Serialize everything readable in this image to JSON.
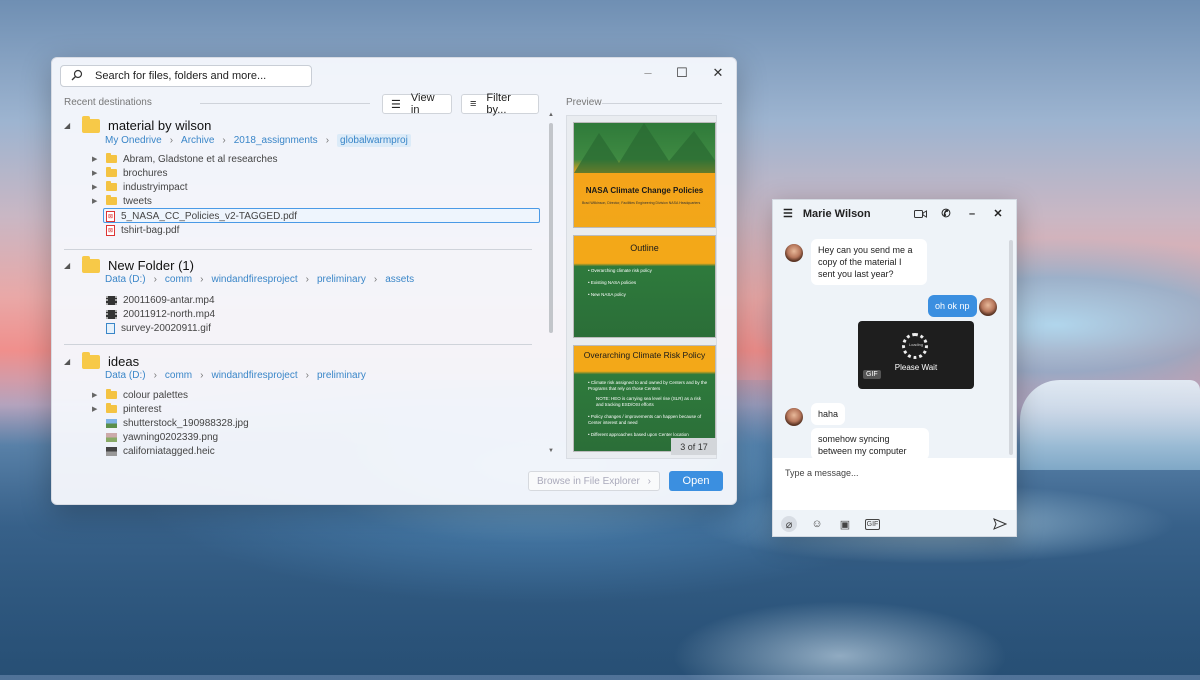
{
  "search": {
    "placeholder": "Search for files, folders and more..."
  },
  "sections": {
    "recent": "Recent destinations",
    "preview": "Preview"
  },
  "toolbar": {
    "view_in": "View in",
    "filter_by": "Filter by..."
  },
  "groups": [
    {
      "title": "material by wilson",
      "crumbs": [
        "My Onedrive",
        "Archive",
        "2018_assignments",
        "globalwarmproj"
      ],
      "items": [
        "Abram, Gladstone et al researches",
        "brochures",
        "industryimpact",
        "tweets",
        "5_NASA_CC_Policies_v2-TAGGED.pdf",
        "tshirt-bag.pdf"
      ]
    },
    {
      "title": "New Folder (1)",
      "crumbs": [
        "Data (D:)",
        "comm",
        "windandfiresproject",
        "preliminary",
        "assets"
      ],
      "items": [
        "20011609-antar.mp4",
        "20011912-north.mp4",
        "survey-20020911.gif"
      ]
    },
    {
      "title": "ideas",
      "crumbs": [
        "Data (D:)",
        "comm",
        "windandfiresproject",
        "preliminary"
      ],
      "items": [
        "colour palettes",
        "pinterest",
        "shutterstock_190988328.jpg",
        "yawning0202339.png",
        "californiatagged.heic"
      ]
    }
  ],
  "slides": {
    "s1_title": "NASA Climate Change Policies",
    "s1_sub": "Brad Wilkinson, Director, Facilities Engineering Division NASA Headquarters",
    "s2_title": "Outline",
    "s2_bullets": [
      "Overarching climate risk policy",
      "Existing NASA policies",
      "New NASA policy"
    ],
    "s3_title": "Overarching Climate Risk Policy",
    "s3_bullets": [
      "Climate risk assigned to and owned by Centers and by the Programs that rely on those Centers",
      "NOTE: HEO is carrying sea level rise (SLR) as a risk and tracking ESD/OSI efforts",
      "Policy changes / improvements can happen because of Center interest and need",
      "Different approaches based upon Center location"
    ],
    "page": "3 of 17"
  },
  "footer": {
    "browse": "Browse in File Explorer",
    "open": "Open"
  },
  "chat": {
    "name": "Marie Wilson",
    "messages": [
      "Hey can you send me a copy of the material I sent you last year?",
      "oh ok np",
      "haha",
      "somehow syncing between my computer and a device didnt merge things but"
    ],
    "gif_text": "Please Wait",
    "gif_loading": "Loading",
    "gif_tag": "GIF",
    "input_placeholder": "Type a message...",
    "gif_button": "GIF"
  }
}
